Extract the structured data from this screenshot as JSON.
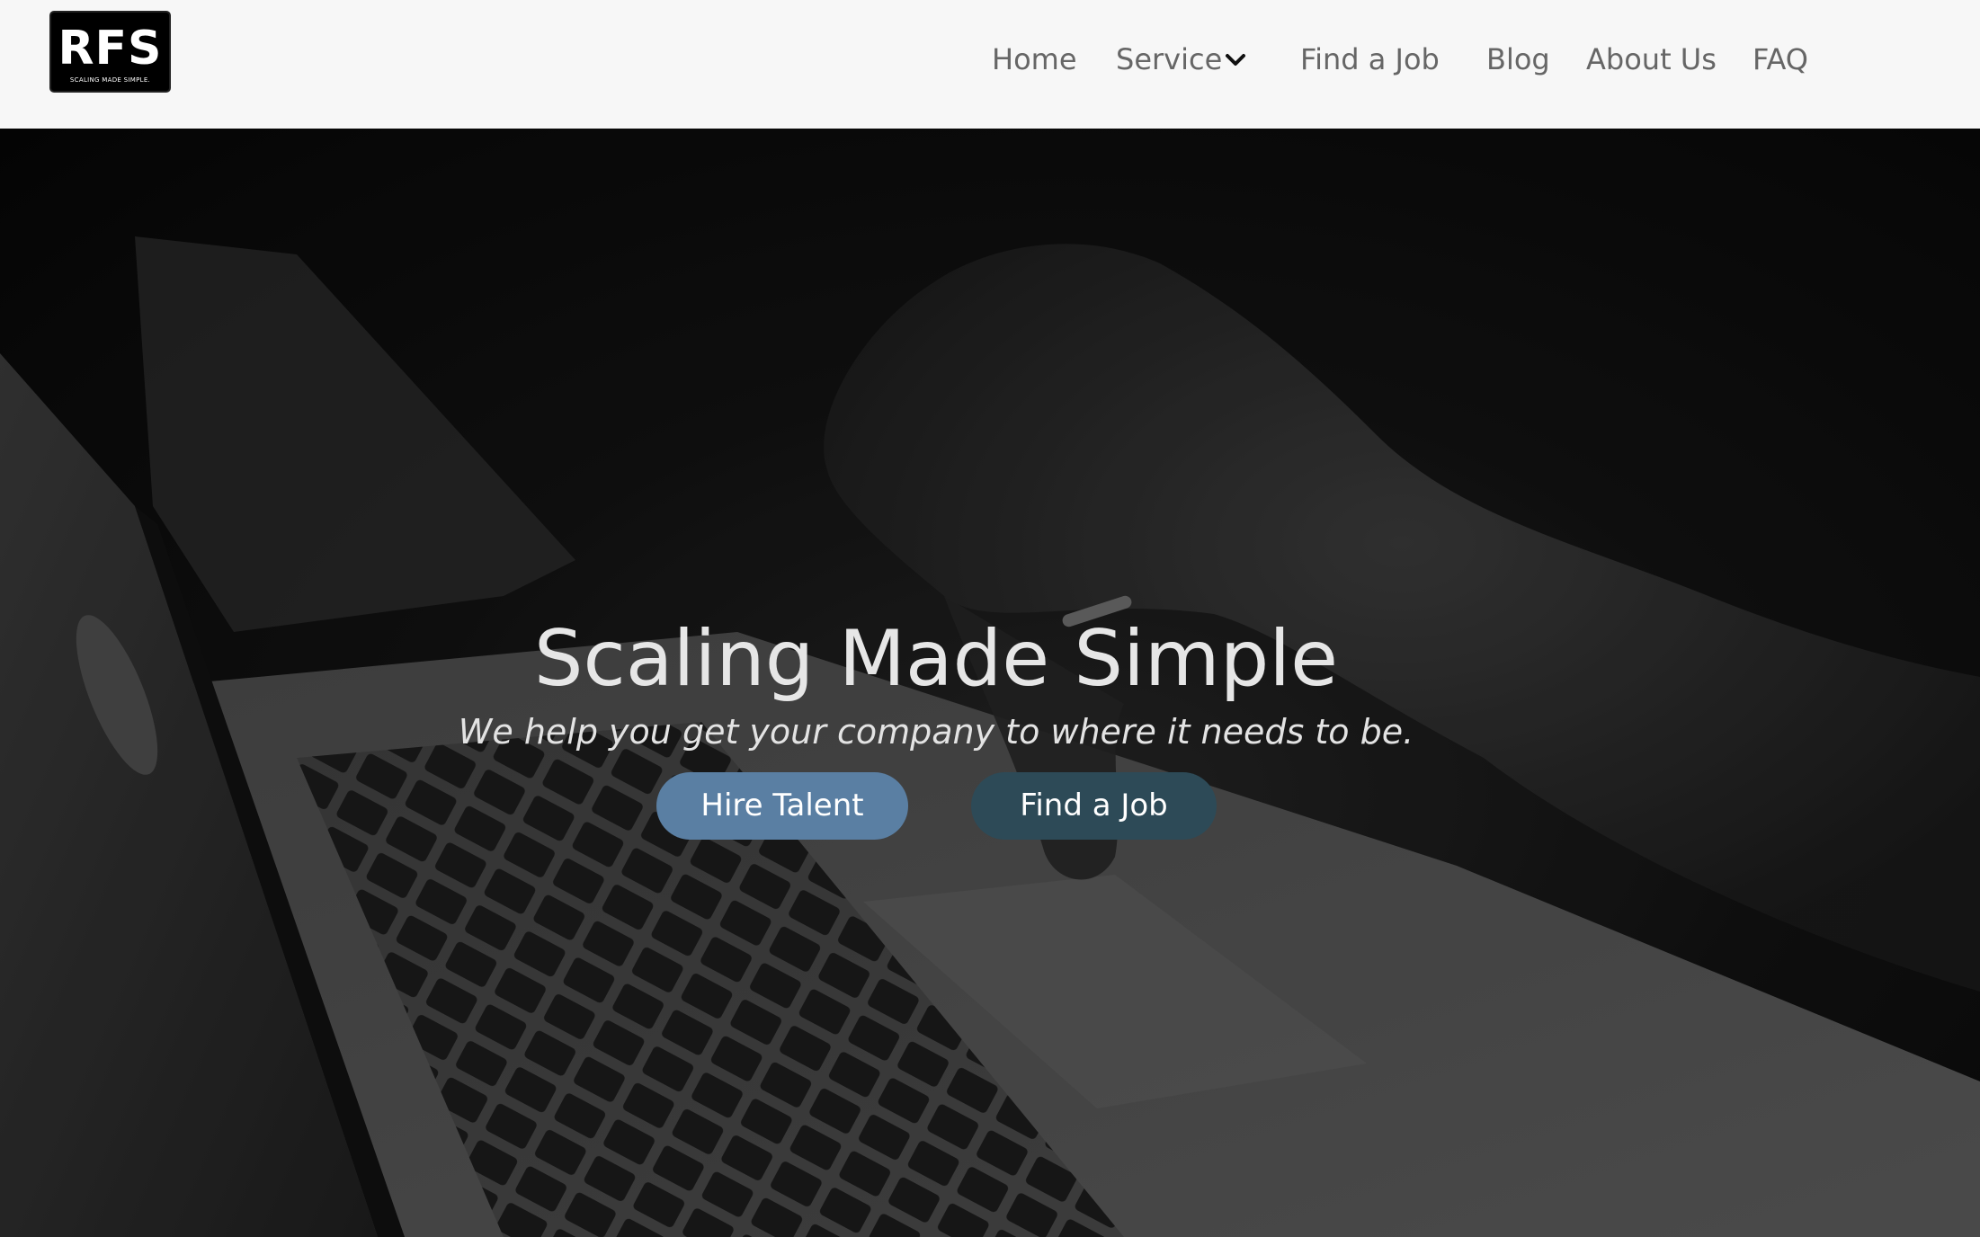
{
  "header": {
    "logo": {
      "text": "RFS",
      "tagline": "SCALING MADE SIMPLE."
    },
    "nav": [
      {
        "label": "Home"
      },
      {
        "label": "Service",
        "icon": "chevron-down-icon"
      },
      {
        "label": "Find a Job"
      },
      {
        "label": "Blog"
      },
      {
        "label": "About Us"
      },
      {
        "label": "FAQ"
      }
    ]
  },
  "hero": {
    "title": "Scaling Made Simple",
    "subtitle": "We help you get your company to where it needs to be.",
    "buttons": {
      "hire_talent": "Hire Talent",
      "find_job": "Find a Job"
    }
  },
  "colors": {
    "header_bg": "#f7f7f7",
    "nav_text": "#666666",
    "hire_button": "#5a7fa3",
    "find_job_button": "#2d4a57",
    "hero_text": "#e6e6e6"
  }
}
